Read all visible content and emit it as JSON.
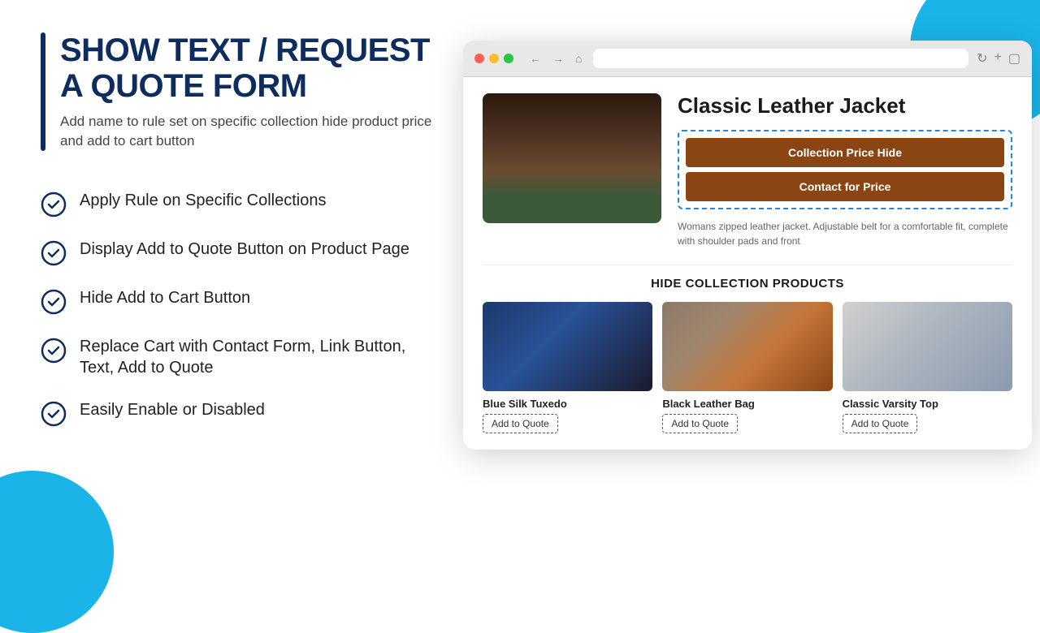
{
  "page": {
    "title": "SHOW TEXT / REQUEST A QUOTE FORM",
    "subtitle": "Add name to rule set on specific collection hide product price and add to cart button"
  },
  "features": [
    {
      "id": "feat-1",
      "text": "Apply Rule on Specific Collections"
    },
    {
      "id": "feat-2",
      "text": "Display Add to Quote Button on Product Page"
    },
    {
      "id": "feat-3",
      "text": "Hide Add to Cart Button"
    },
    {
      "id": "feat-4",
      "text": "Replace Cart with Contact Form, Link Button, Text, Add to Quote"
    },
    {
      "id": "feat-5",
      "text": "Easily Enable or Disabled"
    }
  ],
  "browser": {
    "address": "",
    "product": {
      "name": "Classic Leather Jacket",
      "description": "Womans zipped leather jacket. Adjustable belt for a comfortable fit, complete with shoulder pads and front",
      "btn_collection": "Collection Price Hide",
      "btn_contact": "Contact for Price"
    },
    "collection_section_title": "HIDE COLLECTION PRODUCTS",
    "products": [
      {
        "name": "Blue Silk Tuxedo",
        "btn_label": "Add to Quote",
        "img_class": "img-tuxedo"
      },
      {
        "name": "Black Leather Bag",
        "btn_label": "Add to Quote",
        "img_class": "img-bag"
      },
      {
        "name": "Classic Varsity Top",
        "btn_label": "Add to Quote",
        "img_class": "img-varsity"
      }
    ]
  }
}
